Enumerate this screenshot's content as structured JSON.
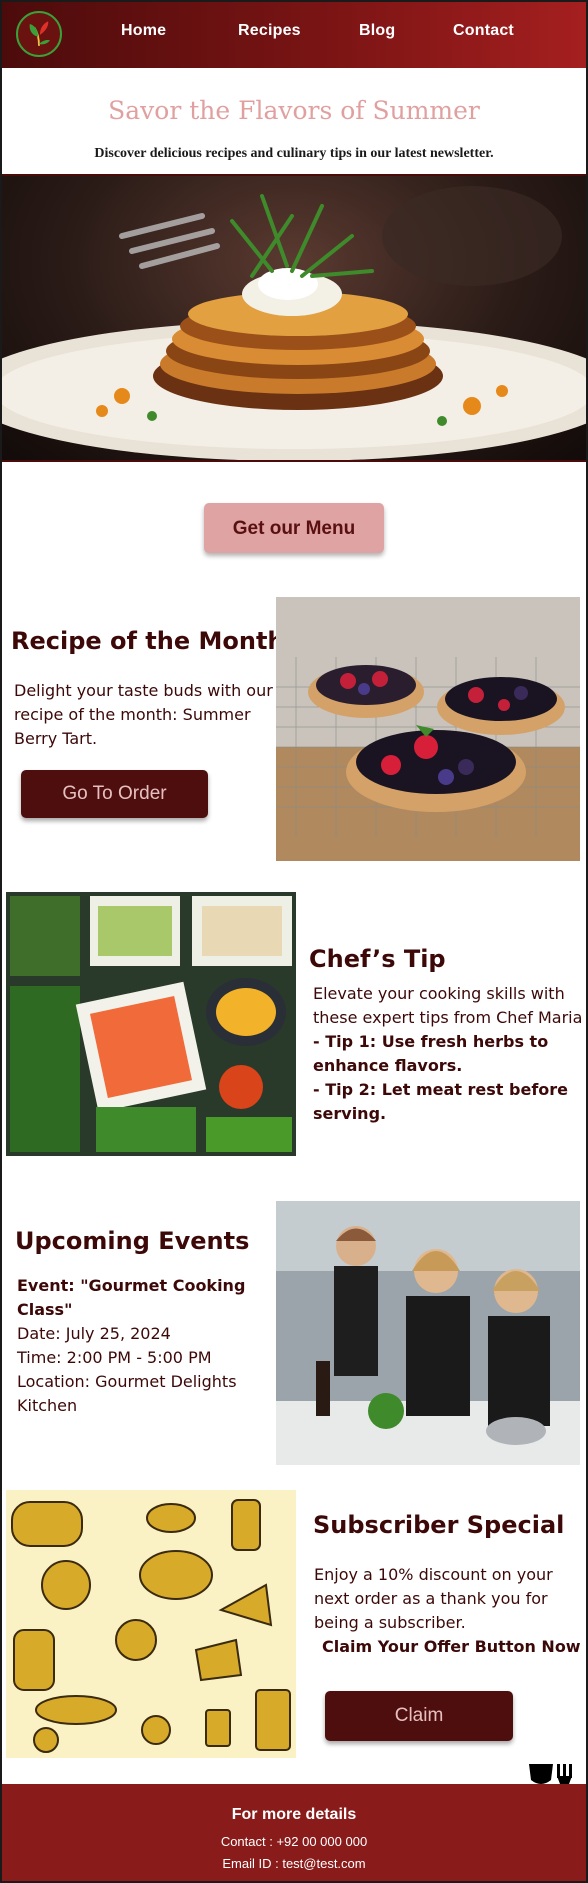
{
  "nav": {
    "items": [
      "Home",
      "Recipes",
      "Blog",
      "Contact"
    ]
  },
  "header": {
    "title": "Savor the Flavors of Summer",
    "subtitle": "Discover delicious recipes and culinary tips in our latest newsletter."
  },
  "menu_button": "Get our Menu",
  "recipe": {
    "title": "Recipe of the Month",
    "text": "Delight your taste buds with our recipe of the month: Summer Berry Tart.",
    "button": "Go To Order"
  },
  "chef_tip": {
    "title": "Chef’s Tip",
    "intro": "Elevate your cooking skills with these expert tips from Chef Maria",
    "tips": [
      "- Tip 1: Use fresh herbs to enhance flavors.",
      "- Tip 2: Let meat rest before serving."
    ]
  },
  "events": {
    "title": "Upcoming Events",
    "event": "Event: \"Gourmet Cooking Class\"",
    "date": "Date: July 25, 2024",
    "time": "Time: 2:00 PM - 5:00 PM",
    "location": "Location: Gourmet Delights Kitchen"
  },
  "subscriber": {
    "title": "Subscriber Special",
    "text": "Enjoy a 10% discount on your next order as a thank you for being a subscriber.",
    "cta": "Claim Your Offer Button Now",
    "button": "Claim"
  },
  "footer": {
    "title": "For more details",
    "contact": "Contact : +92 00 000 000",
    "email": "Email ID : test@test.com"
  },
  "icons": {
    "logo": "plant-logo-icon",
    "utensils": "wine-fork-icon"
  },
  "colors": {
    "brand_dark": "#4f0e0e",
    "brand_red": "#891b1b",
    "accent_pink": "#dfa3a3",
    "title_pink": "#e1a0a0"
  }
}
